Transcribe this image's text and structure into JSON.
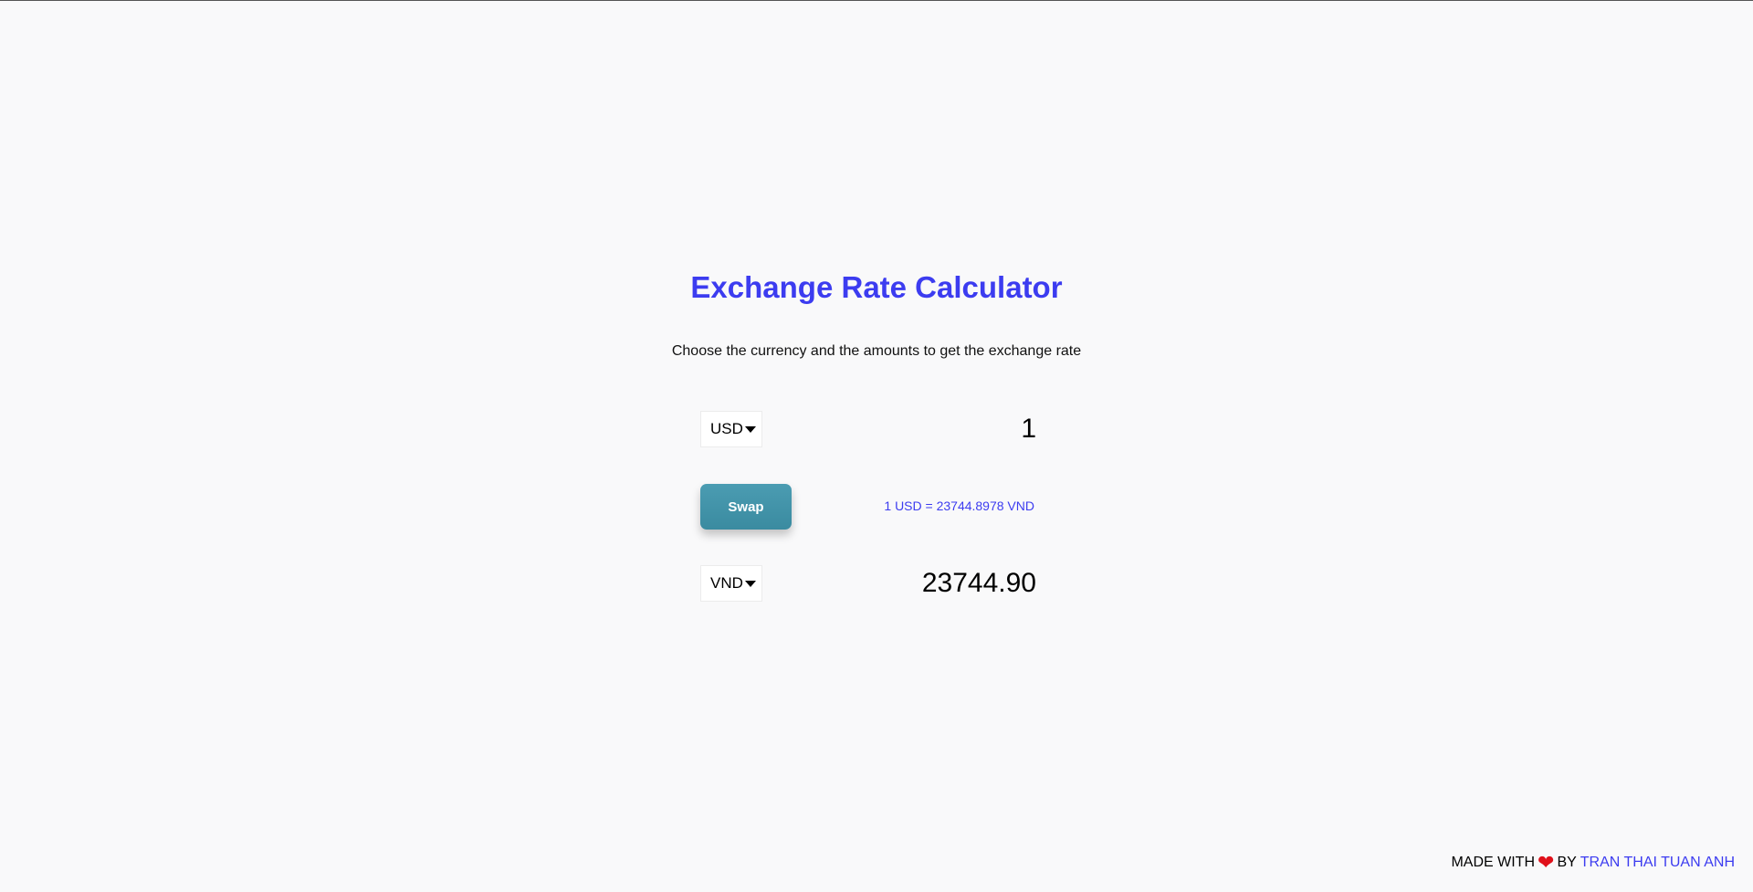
{
  "header": {
    "title": "Exchange Rate Calculator",
    "subtitle": "Choose the currency and the amounts to get the exchange rate"
  },
  "converter": {
    "from": {
      "currency": "USD",
      "amount": "1"
    },
    "swap_label": "Swap",
    "rate_text": "1 USD = 23744.8978 VND",
    "to": {
      "currency": "VND",
      "amount": "23744.90"
    }
  },
  "footer": {
    "made_with": "MADE WITH",
    "heart": "❤",
    "by": "BY",
    "author": "TRAN THAI TUAN ANH"
  },
  "colors": {
    "accent": "#3c3cf0",
    "button": "#4094aa",
    "heart": "#e0101a",
    "background": "#f9f9fa"
  }
}
